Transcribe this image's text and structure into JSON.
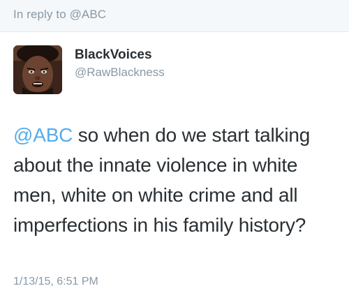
{
  "reply_bar": {
    "text": "In reply to @ABC"
  },
  "author": {
    "display_name": "BlackVoices",
    "handle": "@RawBlackness",
    "avatar_icon": "user-avatar-photo"
  },
  "tweet": {
    "mention": "@ABC",
    "body": " so when do we start talking about the innate violence in white men, white on white crime and all imperfections in his family history?",
    "timestamp": "1/13/15, 6:51 PM"
  },
  "colors": {
    "mention": "#55acee",
    "muted": "#8899a6",
    "text": "#292f33",
    "reply_bar_bg": "#f5f8fa"
  }
}
